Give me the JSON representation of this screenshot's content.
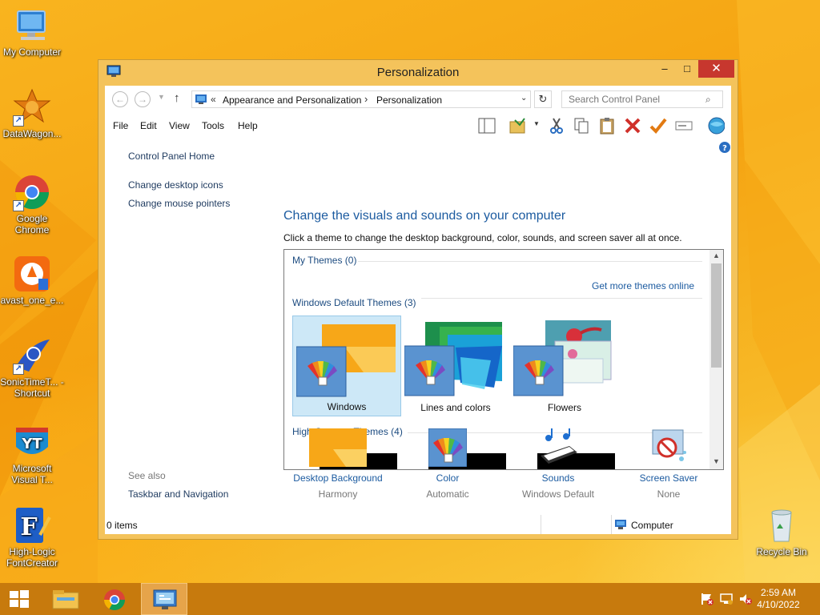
{
  "desktop": {
    "icons": [
      {
        "label": "My Computer"
      },
      {
        "label": "DataWagon..."
      },
      {
        "label": "Google Chrome"
      },
      {
        "label": "avast_one_e..."
      },
      {
        "label": "SonicTimeT... - Shortcut"
      },
      {
        "label": "Microsoft Visual T..."
      },
      {
        "label": "High-Logic FontCreator"
      },
      {
        "label": "Recycle Bin"
      }
    ]
  },
  "window": {
    "title": "Personalization",
    "controls": {
      "minimize": "–",
      "maximize": "□",
      "close": "✕"
    },
    "address": {
      "prefix": "«",
      "crumb1": "Appearance and Personalization",
      "separator": "›",
      "crumb2": "Personalization"
    },
    "search": {
      "placeholder": "Search Control Panel"
    },
    "menu": [
      "File",
      "Edit",
      "View",
      "Tools",
      "Help"
    ],
    "sidebar": {
      "home": "Control Panel Home",
      "links": [
        "Change desktop icons",
        "Change mouse pointers"
      ],
      "see_also_label": "See also",
      "see_also_links": [
        "Taskbar and Navigation"
      ]
    },
    "main": {
      "heading": "Change the visuals and sounds on your computer",
      "subtext": "Click a theme to change the desktop background, color, sounds, and screen saver all at once.",
      "my_themes": "My Themes (0)",
      "get_more": "Get more themes online",
      "default_themes": "Windows Default Themes (3)",
      "themes": [
        {
          "label": "Windows",
          "selected": true
        },
        {
          "label": "Lines and colors",
          "selected": false
        },
        {
          "label": "Flowers",
          "selected": false
        }
      ],
      "high_contrast": "High Contrast Themes (4)"
    },
    "bottom": [
      {
        "label": "Desktop Background",
        "sub": "Harmony"
      },
      {
        "label": "Color",
        "sub": "Automatic"
      },
      {
        "label": "Sounds",
        "sub": "Windows Default"
      },
      {
        "label": "Screen Saver",
        "sub": "None"
      }
    ],
    "status": {
      "items": "0 items",
      "computer": "Computer"
    }
  },
  "taskbar": {
    "time": "2:59 AM",
    "date": "4/10/2022"
  },
  "colors": {
    "accent": "#1c5ba0",
    "window_frame": "#f4c35b",
    "close": "#c7372e",
    "taskbar": "#c77a0d"
  }
}
